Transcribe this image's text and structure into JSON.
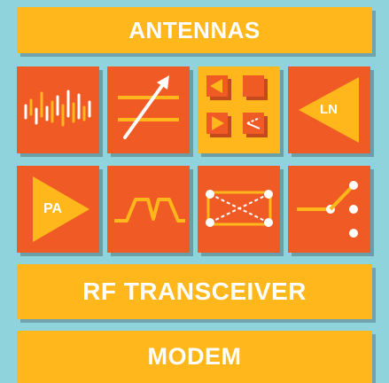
{
  "top_bar": {
    "label": "ANTENNAS"
  },
  "middle_bar": {
    "label": "RF TRANSCEIVER"
  },
  "bottom_bar": {
    "label": "MODEM"
  },
  "tiles": [
    {
      "icon": "waveform-icon"
    },
    {
      "icon": "tunable-filter-icon"
    },
    {
      "icon": "switch-matrix-icon"
    },
    {
      "icon": "lna-icon",
      "label": "LN"
    },
    {
      "icon": "pa-icon",
      "label": "PA"
    },
    {
      "icon": "filter-response-icon"
    },
    {
      "icon": "crossover-switch-icon"
    },
    {
      "icon": "spdt-switch-icon"
    }
  ],
  "colors": {
    "background": "#8fd3dd",
    "bar": "#ffb71b",
    "tile_orange": "#f05a24",
    "tile_yellow": "#ffb71b",
    "icon_primary": "#ffb71b",
    "icon_white": "#ffffff"
  }
}
